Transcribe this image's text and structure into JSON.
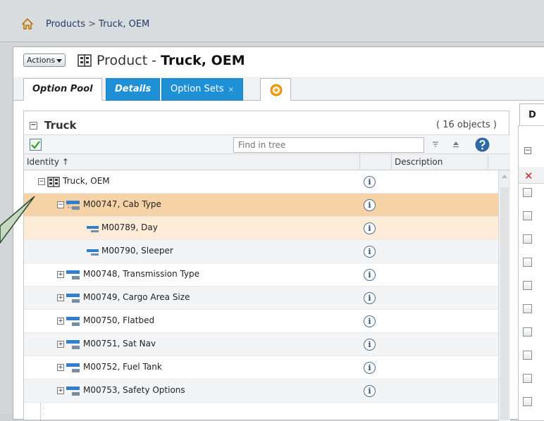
{
  "breadcrumb": {
    "root": "Products",
    "separator": ">",
    "current": "Truck, OEM"
  },
  "header": {
    "actions_label": "Actions",
    "title_prefix": "Product - ",
    "title_name": "Truck, OEM"
  },
  "tabs": [
    {
      "label": "Option Pool",
      "active": true
    },
    {
      "label": "Details",
      "active": false
    },
    {
      "label": "Option Sets",
      "active": false,
      "closable": true,
      "close_glyph": "×"
    }
  ],
  "tree": {
    "title": "Truck",
    "count": "( 16 objects )",
    "search_placeholder": "Find in tree",
    "columns": {
      "identity": "Identity",
      "sort_arrow": "↑",
      "description": "Description"
    },
    "rows": [
      {
        "label": "Truck, OEM",
        "level": 0,
        "expander": "−",
        "icon": "product-icon",
        "state": "normal"
      },
      {
        "label": "M00747, Cab Type",
        "level": 1,
        "expander": "−",
        "icon": "option-icon",
        "state": "selected"
      },
      {
        "label": "M00789, Day",
        "level": 2,
        "expander": "",
        "icon": "option-value-icon",
        "state": "hover"
      },
      {
        "label": "M00790, Sleeper",
        "level": 2,
        "expander": "",
        "icon": "option-value-icon",
        "state": "alt"
      },
      {
        "label": "M00748, Transmission Type",
        "level": 1,
        "expander": "+",
        "icon": "option-icon",
        "state": "normal"
      },
      {
        "label": "M00749, Cargo Area Size",
        "level": 1,
        "expander": "+",
        "icon": "option-icon",
        "state": "alt"
      },
      {
        "label": "M00750, Flatbed",
        "level": 1,
        "expander": "+",
        "icon": "option-icon",
        "state": "normal"
      },
      {
        "label": "M00751, Sat Nav",
        "level": 1,
        "expander": "+",
        "icon": "option-icon",
        "state": "alt"
      },
      {
        "label": "M00752, Fuel Tank",
        "level": 1,
        "expander": "+",
        "icon": "option-icon",
        "state": "normal"
      },
      {
        "label": "M00753, Safety Options",
        "level": 1,
        "expander": "+",
        "icon": "option-icon",
        "state": "alt"
      }
    ],
    "info_glyph": "i"
  },
  "right_panel": {
    "tab_label": "D",
    "delete_glyph": "✕"
  },
  "colors": {
    "tab_blue": "#1f8fd6",
    "selected_row": "#f6d3a7",
    "hover_row": "#fcecd8",
    "callout": "#2f4a2f"
  }
}
